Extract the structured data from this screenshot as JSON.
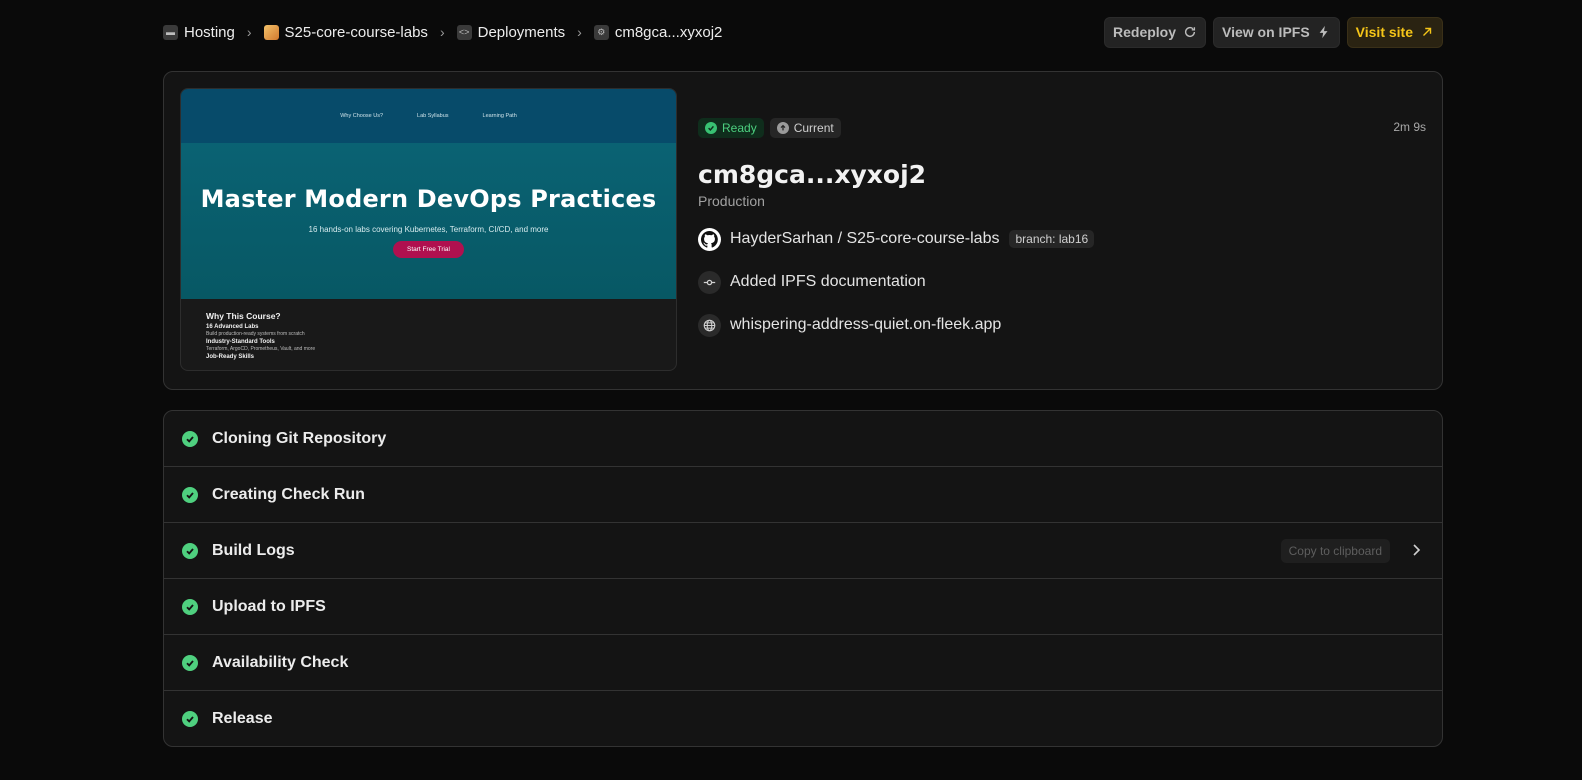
{
  "breadcrumb": {
    "items": [
      {
        "label": "Hosting"
      },
      {
        "label": "S25-core-course-labs"
      },
      {
        "label": "Deployments"
      },
      {
        "label": "cm8gca...xyxoj2"
      }
    ]
  },
  "actions": {
    "redeploy": "Redeploy",
    "view_ipfs": "View on IPFS",
    "visit": "Visit site"
  },
  "preview": {
    "nav": [
      "Why Choose Us?",
      "Lab Syllabus",
      "Learning Path"
    ],
    "title": "Master Modern DevOps Practices",
    "subtitle": "16 hands-on labs covering Kubernetes, Terraform, CI/CD, and more",
    "cta": "Start Free Trial",
    "section_title": "Why This Course?",
    "items": [
      {
        "title": "16 Advanced Labs",
        "desc": "Build production-ready systems from scratch"
      },
      {
        "title": "Industry-Standard Tools",
        "desc": "Terraform, ArgoCD, Prometheus, Vault, and more"
      },
      {
        "title": "Job-Ready Skills",
        "desc": ""
      }
    ]
  },
  "deployment": {
    "status": "Ready",
    "current": "Current",
    "duration": "2m 9s",
    "title": "cm8gca...xyxoj2",
    "environment": "Production",
    "repo": "HayderSarhan / S25-core-course-labs",
    "branch": "branch: lab16",
    "commit_message": "Added IPFS documentation",
    "domain": "whispering-address-quiet.on-fleek.app"
  },
  "steps": [
    {
      "label": "Cloning Git Repository"
    },
    {
      "label": "Creating Check Run"
    },
    {
      "label": "Build Logs"
    },
    {
      "label": "Upload to IPFS"
    },
    {
      "label": "Availability Check"
    },
    {
      "label": "Release"
    }
  ],
  "build_logs": {
    "copy_label": "Copy to clipboard"
  },
  "colors": {
    "background": "#0a0a0a",
    "success": "#4fd07f",
    "accent": "#f5c518",
    "preview_nav": "#074b6a",
    "preview_hero": "#0a6273",
    "preview_cta": "#b0104f"
  }
}
